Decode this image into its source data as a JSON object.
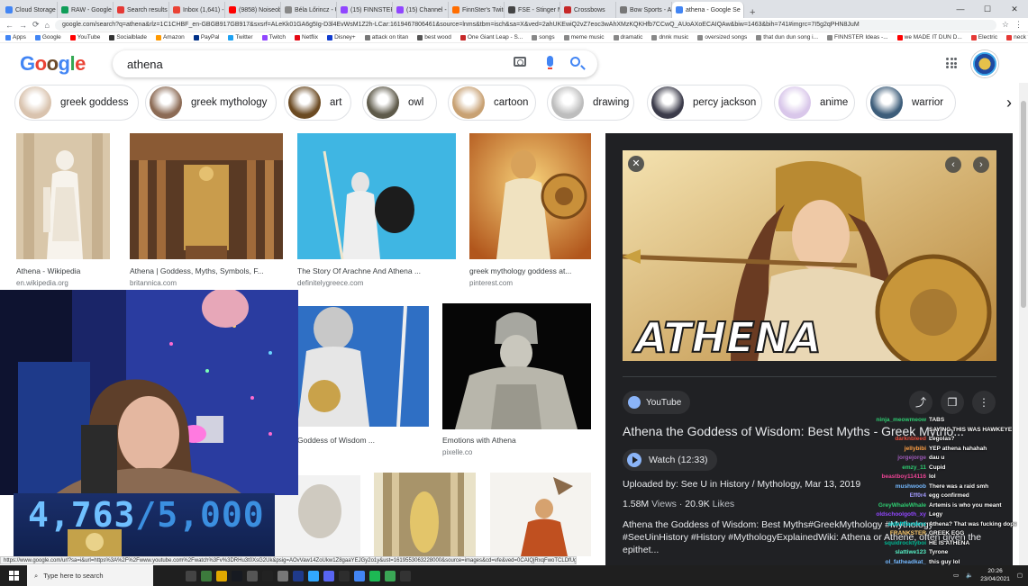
{
  "browser": {
    "tabs": [
      {
        "label": "Cloud Storage for W",
        "color": "#4285f4"
      },
      {
        "label": "RAW - Google Drive",
        "color": "#0f9d58"
      },
      {
        "label": "Search results - fiing",
        "color": "#e53935"
      },
      {
        "label": "Inbox (1,641) - ffirecl",
        "color": "#ea4335"
      },
      {
        "label": "(9858) Noiseobrm",
        "color": "#ff0000"
      },
      {
        "label": "Béla Lőrincz - UK Sci",
        "color": "#888888"
      },
      {
        "label": "(15) FINNSTER's Sch",
        "color": "#9146ff"
      },
      {
        "label": "(15) Channel - Twitch",
        "color": "#9146ff"
      },
      {
        "label": "FinnSter's Twitch Sto",
        "color": "#ff6d00"
      },
      {
        "label": "FSE - Stinger Mod",
        "color": "#444444"
      },
      {
        "label": "Crossbows",
        "color": "#c62828"
      },
      {
        "label": "Bow Sports - Archer",
        "color": "#777777"
      },
      {
        "label": "athena - Google Se",
        "color": "#4285f4",
        "active": true
      }
    ],
    "new_tab": "+",
    "address": "google.com/search?q=athena&rlz=1C1CHBF_en-GBGB917GB917&sxsrf=ALeKk01GA6g5Ig-D3l4EvWsM1Z2h-LCar:1619467806461&source=lnms&tbm=isch&sa=X&ved=2ahUKEwiQ2vZ7eoc3wAhXMzKQKHfb7CCwQ_AUoAXoECAIQAw&biw=1463&bih=741#imgrc=7I5g2qPHN8JuM",
    "bookmarks": [
      {
        "label": "Apps",
        "color": "#4285f4"
      },
      {
        "label": "Google",
        "color": "#4285f4"
      },
      {
        "label": "YouTube",
        "color": "#ff0000"
      },
      {
        "label": "Socialblade",
        "color": "#333333"
      },
      {
        "label": "Amazon",
        "color": "#ff9900"
      },
      {
        "label": "PayPal",
        "color": "#003087"
      },
      {
        "label": "Twitter",
        "color": "#1da1f2"
      },
      {
        "label": "Twitch",
        "color": "#9146ff"
      },
      {
        "label": "Netflix",
        "color": "#e50914"
      },
      {
        "label": "Disney+",
        "color": "#113ccf"
      },
      {
        "label": "attack on titan",
        "color": "#777777"
      },
      {
        "label": "best wood",
        "color": "#555555"
      },
      {
        "label": "One Giant Leap - S...",
        "color": "#c62828"
      },
      {
        "label": "songs",
        "color": "#888888"
      },
      {
        "label": "meme music",
        "color": "#888888"
      },
      {
        "label": "dramatic",
        "color": "#888888"
      },
      {
        "label": "dnnk music",
        "color": "#888888"
      },
      {
        "label": "oversized songs",
        "color": "#888888"
      },
      {
        "label": "that dun dun song i...",
        "color": "#888888"
      },
      {
        "label": "FINNSTER Ideas -...",
        "color": "#888888"
      },
      {
        "label": "we MADE IT DUN D...",
        "color": "#ff0000"
      },
      {
        "label": "Electric",
        "color": "#e53935"
      },
      {
        "label": "neck folder",
        "color": "#e53935"
      },
      {
        "label": "audio inter",
        "color": "#333333"
      },
      {
        "label": "Reading list",
        "color": "#333333"
      }
    ]
  },
  "google": {
    "query": "athena",
    "chips": [
      {
        "label": "greek goddess",
        "color": "#d9c3ae"
      },
      {
        "label": "greek mythology",
        "color": "#8c6b55"
      },
      {
        "label": "art",
        "color": "#6b4a22"
      },
      {
        "label": "owl",
        "color": "#5e5a4a"
      },
      {
        "label": "cartoon",
        "color": "#c8a173"
      },
      {
        "label": "drawing",
        "color": "#bdbdbd"
      },
      {
        "label": "percy jackson",
        "color": "#3b3b4a"
      },
      {
        "label": "anime",
        "color": "#d9c7ea"
      },
      {
        "label": "warrior",
        "color": "#3d5d7a"
      }
    ],
    "results": [
      {
        "caption": "Athena - Wikipedia",
        "source": "en.wikipedia.org"
      },
      {
        "caption": "Athena | Goddess, Myths, Symbols, F...",
        "source": "britannica.com"
      },
      {
        "caption": "The Story Of Arachne And Athena ...",
        "source": "definitelygreece.com"
      },
      {
        "caption": "greek mythology goddess at...",
        "source": "pinterest.com"
      },
      {
        "caption": "Goddess of Wisdom ...",
        "source": ""
      },
      {
        "caption": "Emotions with Athena",
        "source": "pixelle.co"
      }
    ]
  },
  "panel": {
    "hero_text": "ATHENA",
    "source": "YouTube",
    "title": "Athena the Goddess of Wisdom: Best Myths - Greek Mytho...",
    "watch_label": "Watch (12:33)",
    "uploaded": "Uploaded by: See U in History / Mythology, Mar 13, 2019",
    "views": "1.58M",
    "views_label": "Views",
    "likes": "20.9K",
    "likes_label": "Likes",
    "description": "Athena the Goddess of Wisdom: Best Myths#GreekMythology #Mythology #SeeUinHistory #History #MythologyExplainedWiki: Athena or Athene, often given the epithet..."
  },
  "stream": {
    "counter_current": "4,763",
    "counter_sep": "/",
    "counter_goal": "5,000",
    "chat": [
      {
        "user": "ninja_meowmeow",
        "msg": "TABS",
        "color": "#2ecc71"
      },
      {
        "user": "",
        "msg": "SAYING THIS WAS HAWKEYE",
        "color": "#ffffff"
      },
      {
        "user": "darknbleed",
        "msg": "Legolas?",
        "color": "#e74c3c"
      },
      {
        "user": "jellybibi",
        "msg": "YEP athena hahahah",
        "color": "#ff9f43"
      },
      {
        "user": "jorgejorge",
        "msg": "dau u",
        "color": "#9b59b6"
      },
      {
        "user": "emzy_11",
        "msg": "Cupid",
        "color": "#2ecc71"
      },
      {
        "user": "beastboy114116",
        "msg": "lol",
        "color": "#e84393"
      },
      {
        "user": "mushwoob",
        "msg": "There was a raid smh",
        "color": "#74b9ff"
      },
      {
        "user": "Eff0r4",
        "msg": "egg confirmed",
        "color": "#a29bfe"
      },
      {
        "user": "GreyWhaleWhale",
        "msg": "Artemis is who you meant",
        "color": "#2ecc71"
      },
      {
        "user": "oldschoolgoth_xy",
        "msg": "Legy",
        "color": "#9146ff"
      },
      {
        "user": "aldeftflanders",
        "msg": "Athena? That was fucking dope",
        "color": "#00cec9"
      },
      {
        "user": "FRANKSTER",
        "msg": "GREEK EGG",
        "color": "#fdcb6e"
      },
      {
        "user": "squidrocktyboi",
        "msg": "HE IS ATHENA",
        "color": "#00b894"
      },
      {
        "user": "slattiwe123",
        "msg": "Tyrone",
        "color": "#55efc4"
      },
      {
        "user": "ol_fatheadkat_",
        "msg": "this guy lol",
        "color": "#74b9ff"
      }
    ]
  },
  "status_url": "https://www.google.com/url?sa=i&url=https%3A%2F%2Fwww.youtube.com%2Fwatch%3Fv%3DRHu3t0XsG2Uk&psig=AOvVaw14ZoUkw1Z8gaaYEJGy2o1y&ust=1619553063228000&source=images&cd=vfe&ved=0CAIQjRxqFwoTCLDfUgx4QyAAAAAAdAAAAAAAAD",
  "taskbar": {
    "search_placeholder": "Type here to search",
    "time": "20:26",
    "date": "23/04/2021"
  }
}
